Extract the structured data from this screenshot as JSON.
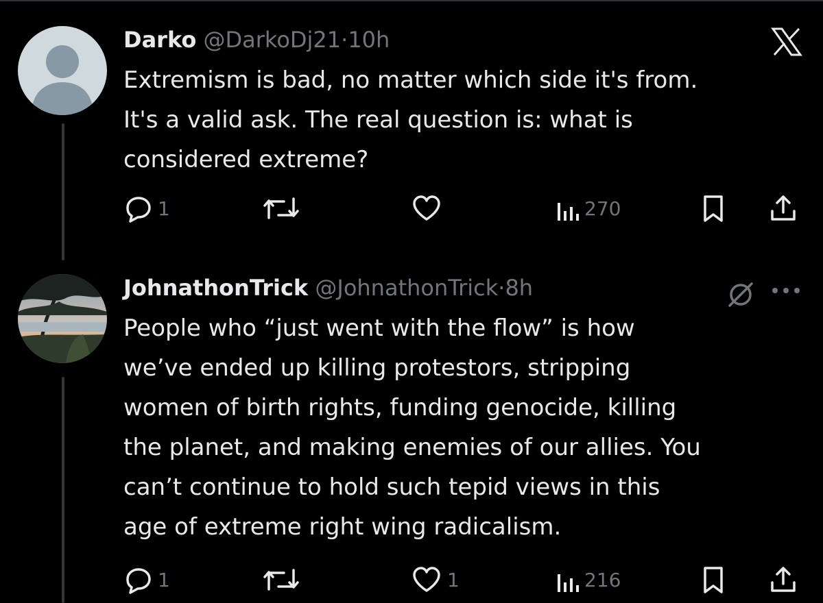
{
  "tweets": [
    {
      "name": "Darko",
      "handle": "@DarkoDj21",
      "separator": "·",
      "time": "10h",
      "lines": [
        "Extremism is bad, no matter which side it's from.",
        "It's a valid ask. The real question is: what is",
        "considered extreme?"
      ],
      "replies": "1",
      "retweets": "",
      "likes": "",
      "views": "270"
    },
    {
      "name": "JohnathonTrick",
      "handle": "@JohnathonTrick",
      "separator": "·",
      "time": "8h",
      "lines": [
        "People who “just went with the flow” is how",
        "we’ve ended up killing protestors, stripping",
        "women of birth rights, funding genocide, killing",
        "the planet, and making enemies of our allies. You",
        "can’t continue to hold such tepid views in this",
        "age of extreme right wing radicalism."
      ],
      "replies": "1",
      "retweets": "",
      "likes": "1",
      "views": "216"
    }
  ],
  "icons": {
    "close": "x-logo-icon",
    "reply": "reply-icon",
    "retweet": "retweet-icon",
    "like": "like-icon",
    "views": "views-icon",
    "bookmark": "bookmark-icon",
    "share": "share-icon",
    "verified": "verified-icon",
    "more": "more-icon"
  },
  "colors": {
    "background": "#000000",
    "text": "#e7e9ea",
    "muted": "#71767b",
    "thread_line": "#333639"
  }
}
